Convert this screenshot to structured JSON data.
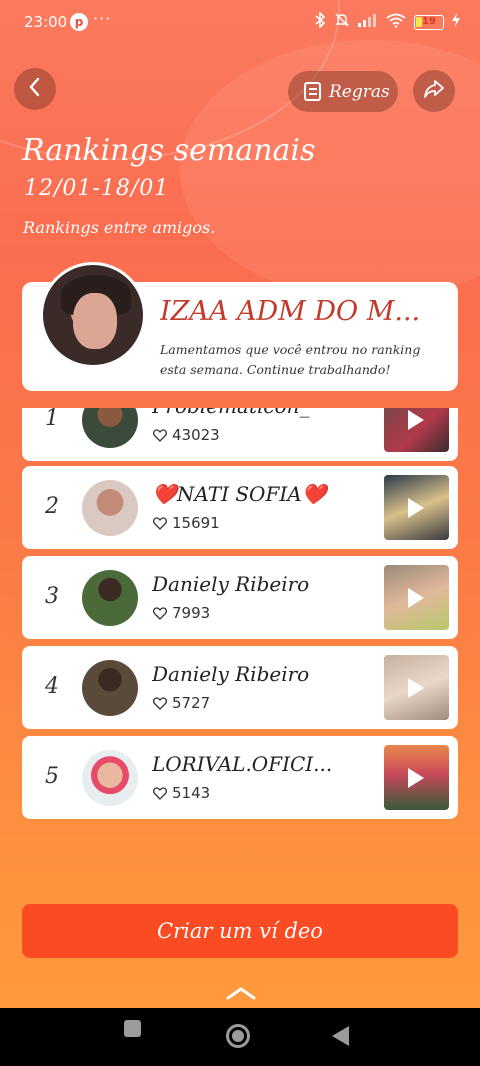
{
  "status_bar": {
    "time": "23:00",
    "pinterest_glyph": "p",
    "more": "···",
    "icons": [
      "bluetooth-icon",
      "mute-icon",
      "signal-icon",
      "wifi-icon"
    ],
    "battery": "19"
  },
  "header": {
    "rules_label": "Regras",
    "title": "Rankings semanais",
    "dates": "12/01-18/01",
    "subtitle": "Rankings entre amigos."
  },
  "highlight": {
    "name": "IZAA ADM DO M...",
    "message": "Lamentamos que você entrou no ranking esta semana. Continue trabalhando!"
  },
  "ranking": [
    {
      "rank": "1",
      "name": "Problematicon_",
      "likes": "43023"
    },
    {
      "rank": "2",
      "name": "❤️NATI SOFIA❤️",
      "likes": "15691"
    },
    {
      "rank": "3",
      "name": "Daniely Ribeiro",
      "likes": "7993"
    },
    {
      "rank": "4",
      "name": "Daniely Ribeiro",
      "likes": "5727"
    },
    {
      "rank": "5",
      "name": "LORIVAL.OFICI...",
      "likes": "5143"
    }
  ],
  "create_button": "Criar um ví deo",
  "colors": {
    "accent": "#fa4b22",
    "name_red": "#c23a2b",
    "bg_top": "#fb7a5e",
    "bg_bottom": "#fe9a3c"
  }
}
